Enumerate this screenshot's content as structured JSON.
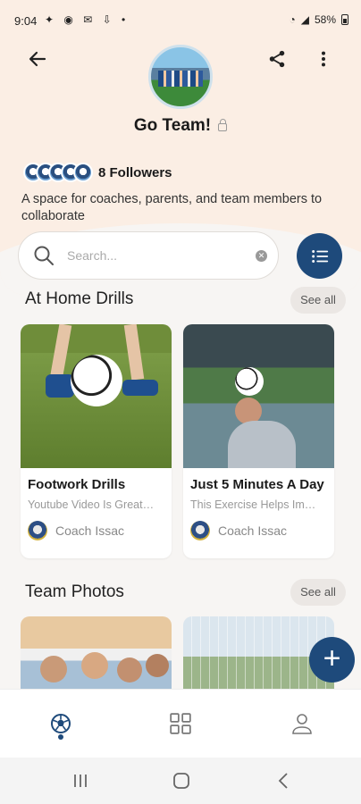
{
  "status_bar": {
    "time": "9:04",
    "battery": "58%"
  },
  "header": {
    "group_name": "Go Team!"
  },
  "followers": {
    "count_label": "8 Followers"
  },
  "description": "A space for coaches, parents, and team members to collaborate",
  "search": {
    "placeholder": "Search..."
  },
  "sections": {
    "drills": {
      "title": "At Home Drills",
      "see_all": "See all"
    },
    "photos": {
      "title": "Team Photos",
      "see_all": "See all"
    }
  },
  "drill_cards": [
    {
      "title": "Footwork Drills",
      "subtitle": "Youtube Video Is Great…",
      "author": "Coach Issac"
    },
    {
      "title": "Just 5 Minutes A Day",
      "subtitle": "This Exercise Helps Im…",
      "author": "Coach Issac"
    }
  ],
  "colors": {
    "accent": "#1e4a7b",
    "header_bg": "#fbeee4",
    "page_bg": "#f7f5f3"
  },
  "icons": [
    "back-arrow-icon",
    "share-icon",
    "more-vert-icon",
    "lock-icon",
    "search-icon",
    "clear-icon",
    "list-icon",
    "add-icon",
    "home-ball-icon",
    "grid-icon",
    "profile-icon"
  ]
}
